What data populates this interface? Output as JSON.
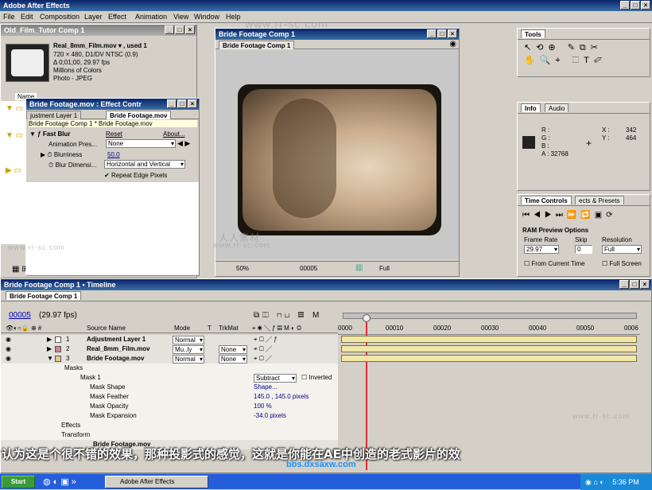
{
  "app": {
    "title": "Adobe After Effects"
  },
  "menu": [
    "File",
    "Edit",
    "Composition",
    "Layer",
    "Effect",
    "Animation",
    "View",
    "Window",
    "Help"
  ],
  "project": {
    "title": "Old_Film_Tutor Comp 1",
    "file": "Real_8mm_Film.mov ▾ , used 1",
    "info1": "720 × 480, D1/DV NTSC (0.9)",
    "info2": "Δ 0;01;00, 29.97 fps",
    "info3": "Millions of Colors",
    "info4": "Photo - JPEG",
    "name_col": "Name"
  },
  "effects": {
    "title": "Bride Footage.mov : Effect Contr",
    "tab1": "justment Layer 1",
    "tab2": "Bride Footage.mov",
    "path": "Bride Footage Comp 1 * Bride Footage.mov",
    "fx_name": "Fast Blur",
    "reset": "Reset",
    "about": "About...",
    "anim_label": "Animation Pres...",
    "anim_value": "None",
    "blurriness_label": "Blurriness",
    "blurriness_value": "50.0",
    "dim_label": "Blur Dimensi...",
    "dim_value": "Horizontal and Vertical",
    "repeat_label": "Repeat Edge Pixels"
  },
  "comp": {
    "title": "Bride Footage Comp 1",
    "tab": "Bride Footage Comp 1",
    "zoom": "50%",
    "timecode": "00005",
    "res": "Full"
  },
  "tools": {
    "title": "Tools"
  },
  "info": {
    "tab_info": "Info",
    "tab_audio": "Audio",
    "r": "R :",
    "g": "G :",
    "b": "B :",
    "a": "A : 32768",
    "x": "X :",
    "xv": "342",
    "y": "Y :",
    "yv": "464"
  },
  "time_controls": {
    "tab": "Time Controls",
    "tab2": "ects & Presets",
    "ram": "RAM Preview Options",
    "frame_rate_label": "Frame Rate",
    "frame_rate": "29.97",
    "skip_label": "Skip",
    "skip": "0",
    "resolution_label": "Resolution",
    "resolution": "Full",
    "from_current": "From Current Time",
    "full_screen": "Full Screen"
  },
  "timeline": {
    "title": "Bride Footage Comp 1 • Timeline",
    "tab": "Bride Footage Comp 1",
    "timecode": "00005",
    "fps": "(29.97 fps)",
    "col_source": "Source Name",
    "col_mode": "Mode",
    "col_t": "T",
    "col_trkmat": "TrkMat",
    "ruler": [
      "0000",
      "00010",
      "00020",
      "00030",
      "00040",
      "00050",
      "0006"
    ],
    "layers": [
      {
        "num": "1",
        "name": "Adjustment Layer 1",
        "mode": "Normal",
        "trk": ""
      },
      {
        "num": "2",
        "name": "Real_8mm_Film.mov",
        "mode": "Mu..ly",
        "trk": "None"
      },
      {
        "num": "3",
        "name": "Bride Footage.mov",
        "mode": "Normal",
        "trk": "None"
      }
    ],
    "masks": "Masks",
    "mask1": "Mask 1",
    "mask_mode": "Subtract",
    "inverted": "Inverted",
    "shape": "Mask Shape",
    "shape_v": "Shape...",
    "feather": "Mask Feather",
    "feather_v": "145.0 , 145.0 pixels",
    "opacity": "Mask Opacity",
    "opacity_v": "100 %",
    "expansion": "Mask Expansion",
    "expansion_v": "-34.0 pixels",
    "effects": "Effects",
    "transform": "Transform",
    "layer4": "Bride Footage.mov"
  },
  "subtitle": "认为这是个很不错的效果，那种投影式的感觉，这就是你能在AE中创造的老式影片的效",
  "watermark": "www.rr-sc.com",
  "watermark2": "人人素材",
  "watermark3": "bbs.dxsaxw.com",
  "taskbar": {
    "start": "Start",
    "task": "Adobe After Effects",
    "clock": "5:36 PM"
  }
}
